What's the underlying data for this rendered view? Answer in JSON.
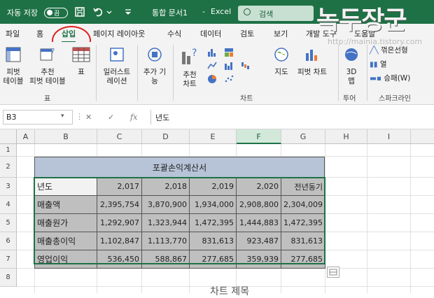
{
  "titlebar": {
    "autosave_label": "자동 저장",
    "autosave_state": "끔",
    "doc_title": "통합 문서1",
    "separator": "-",
    "app_name": "Excel",
    "search_placeholder": "검색"
  },
  "watermark": {
    "title": "녹두장군",
    "url": "http://mainia.tistory.com"
  },
  "tabs": [
    "파일",
    "홈",
    "삽입",
    "페이지 레이아웃",
    "수식",
    "데이터",
    "검토",
    "보기",
    "개발 도구",
    "도움말"
  ],
  "active_tab": "삽입",
  "ribbon": {
    "pivot_table": "피벗\n테이블",
    "recommended_pivot": "추천\n피벗 테이블",
    "table": "표",
    "group_table": "표",
    "illustrations": "일러스트\n레이션",
    "addins": "추가 기\n능",
    "recommended_charts": "추천\n차트",
    "group_charts": "차트",
    "maps": "지도",
    "pivot_chart": "피벗 차트",
    "map3d": "3D\n맵",
    "group_tours": "투어",
    "sparkline_line": "꺾은선형",
    "sparkline_column": "열",
    "sparkline_winloss": "승패(W)",
    "group_sparklines": "스파크라인"
  },
  "formula_bar": {
    "name_box": "B3",
    "fx": "fx",
    "value": "년도"
  },
  "columns": [
    "A",
    "B",
    "C",
    "D",
    "E",
    "F",
    "G",
    "H",
    "I"
  ],
  "rows": [
    "1",
    "2",
    "3",
    "4",
    "5",
    "6",
    "7",
    "8"
  ],
  "sheet": {
    "title": "포괄손익계산서",
    "header_row": [
      "년도",
      "2,017",
      "2,018",
      "2,019",
      "2,020",
      "전년동기"
    ],
    "data_rows": [
      [
        "매출액",
        "2,395,754",
        "3,870,900",
        "1,934,000",
        "2,908,800",
        "2,304,009"
      ],
      [
        "매출원가",
        "1,292,907",
        "1,323,944",
        "1,472,395",
        "1,444,883",
        "1,472,395"
      ],
      [
        "매출총이익",
        "1,102,847",
        "1,113,770",
        "831,613",
        "923,487",
        "831,613"
      ],
      [
        "영업이익",
        "536,450",
        "588,867",
        "277,685",
        "359,939",
        "277,685"
      ]
    ]
  },
  "chart_title": "차트 제목"
}
